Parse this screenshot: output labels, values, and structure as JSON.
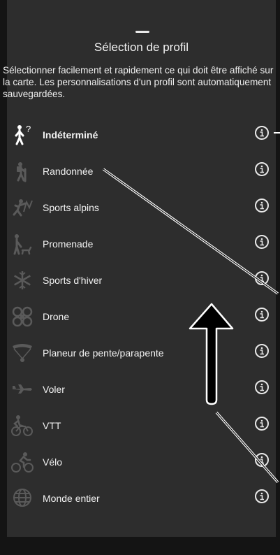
{
  "sheet": {
    "title": "Sélection de profil",
    "description": "Sélectionner facilement et rapidement ce qui doit être affiché sur la carte. Les personnalisations d'un profil sont automatiquement sauvegardées."
  },
  "profiles": [
    {
      "label": "Indéterminé",
      "icon": "person-question-icon",
      "active": true
    },
    {
      "label": "Randonnée",
      "icon": "hiker-icon"
    },
    {
      "label": "Sports alpins",
      "icon": "climber-icon"
    },
    {
      "label": "Promenade",
      "icon": "walk-dog-icon"
    },
    {
      "label": "Sports d'hiver",
      "icon": "snowflake-icon"
    },
    {
      "label": "Drone",
      "icon": "drone-icon"
    },
    {
      "label": "Planeur de pente/parapente",
      "icon": "paraglider-icon"
    },
    {
      "label": "Voler",
      "icon": "plane-icon"
    },
    {
      "label": "VTT",
      "icon": "mountain-bike-icon"
    },
    {
      "label": "Vélo",
      "icon": "bicycle-icon"
    },
    {
      "label": "Monde entier",
      "icon": "globe-icon"
    }
  ],
  "colors": {
    "active": "#ffffff",
    "inactive": "#5a5a5a",
    "sheet": "#2d2d2d"
  }
}
